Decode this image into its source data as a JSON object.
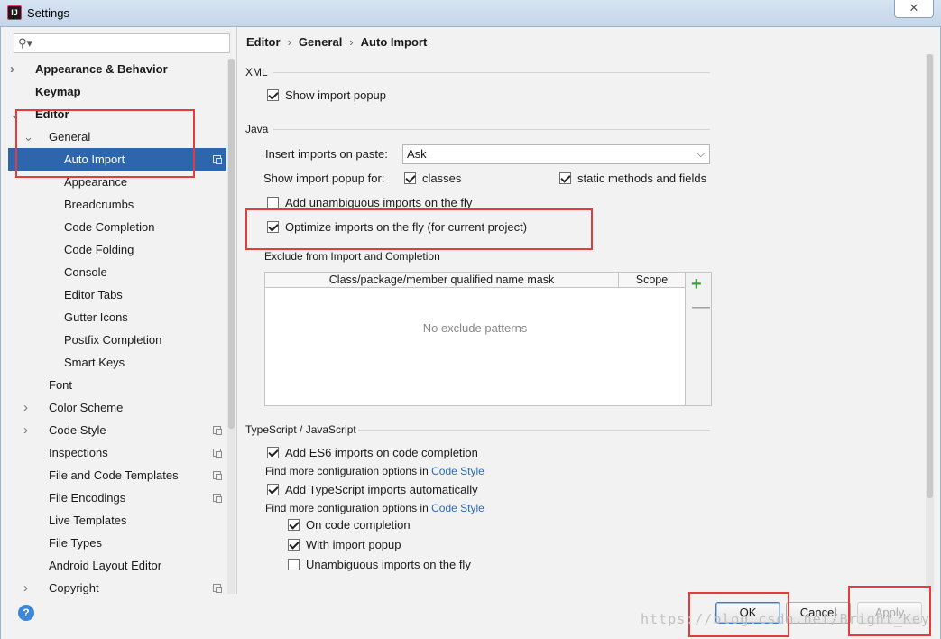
{
  "window": {
    "title": "Settings",
    "close_glyph": "✕"
  },
  "search": {
    "placeholder": "",
    "icon": "search-icon"
  },
  "sidebar": {
    "items": [
      {
        "label": "Appearance & Behavior",
        "indent": 0,
        "arrow": "right",
        "bold": true
      },
      {
        "label": "Keymap",
        "indent": 0,
        "arrow": "",
        "bold": true
      },
      {
        "label": "Editor",
        "indent": 0,
        "arrow": "down",
        "bold": true
      },
      {
        "label": "General",
        "indent": 1,
        "arrow": "down"
      },
      {
        "label": "Auto Import",
        "indent": 2,
        "arrow": "",
        "selected": true,
        "copy_icon": true
      },
      {
        "label": "Appearance",
        "indent": 2,
        "arrow": ""
      },
      {
        "label": "Breadcrumbs",
        "indent": 2,
        "arrow": ""
      },
      {
        "label": "Code Completion",
        "indent": 2,
        "arrow": ""
      },
      {
        "label": "Code Folding",
        "indent": 2,
        "arrow": ""
      },
      {
        "label": "Console",
        "indent": 2,
        "arrow": ""
      },
      {
        "label": "Editor Tabs",
        "indent": 2,
        "arrow": ""
      },
      {
        "label": "Gutter Icons",
        "indent": 2,
        "arrow": ""
      },
      {
        "label": "Postfix Completion",
        "indent": 2,
        "arrow": ""
      },
      {
        "label": "Smart Keys",
        "indent": 2,
        "arrow": ""
      },
      {
        "label": "Font",
        "indent": 1,
        "arrow": ""
      },
      {
        "label": "Color Scheme",
        "indent": 1,
        "arrow": "right"
      },
      {
        "label": "Code Style",
        "indent": 1,
        "arrow": "right",
        "copy_icon": true
      },
      {
        "label": "Inspections",
        "indent": 1,
        "arrow": "",
        "copy_icon": true
      },
      {
        "label": "File and Code Templates",
        "indent": 1,
        "arrow": "",
        "copy_icon": true
      },
      {
        "label": "File Encodings",
        "indent": 1,
        "arrow": "",
        "copy_icon": true
      },
      {
        "label": "Live Templates",
        "indent": 1,
        "arrow": ""
      },
      {
        "label": "File Types",
        "indent": 1,
        "arrow": ""
      },
      {
        "label": "Android Layout Editor",
        "indent": 1,
        "arrow": ""
      },
      {
        "label": "Copyright",
        "indent": 1,
        "arrow": "right",
        "copy_icon": true
      }
    ]
  },
  "breadcrumb": {
    "part1": "Editor",
    "part2": "General",
    "part3": "Auto Import",
    "separator": "›"
  },
  "xml": {
    "title": "XML",
    "show_import_popup": {
      "label": "Show import popup",
      "checked": true
    }
  },
  "java": {
    "title": "Java",
    "insert_label": "Insert imports on paste:",
    "insert_value": "Ask",
    "show_popup_for_label": "Show import popup for:",
    "classes": {
      "label": "classes",
      "checked": true
    },
    "static_methods": {
      "label": "static methods and fields",
      "checked": true
    },
    "add_unambiguous": {
      "label": "Add unambiguous imports on the fly",
      "checked": false
    },
    "optimize": {
      "label": "Optimize imports on the fly (for current project)",
      "checked": true
    },
    "exclude_label": "Exclude from Import and Completion",
    "table_col1": "Class/package/member qualified name mask",
    "table_col2": "Scope",
    "table_empty": "No exclude patterns",
    "add_glyph": "+",
    "remove_glyph": "—"
  },
  "typescript": {
    "title": "TypeScript / JavaScript",
    "add_es6": {
      "label": "Add ES6 imports on code completion",
      "checked": true
    },
    "find_more_1": "Find more configuration options in ",
    "code_style_link_1": "Code Style",
    "add_ts": {
      "label": "Add TypeScript imports automatically",
      "checked": true
    },
    "find_more_2": "Find more configuration options in ",
    "code_style_link_2": "Code Style",
    "on_completion": {
      "label": "On code completion",
      "checked": true
    },
    "with_popup": {
      "label": "With import popup",
      "checked": true
    },
    "unambiguous_fly": {
      "label": "Unambiguous imports on the fly",
      "checked": false
    }
  },
  "buttons": {
    "help": "?",
    "ok": "OK",
    "cancel": "Cancel",
    "apply": "Apply"
  },
  "watermark": "https://blog.csdn.net/Bright_Key"
}
